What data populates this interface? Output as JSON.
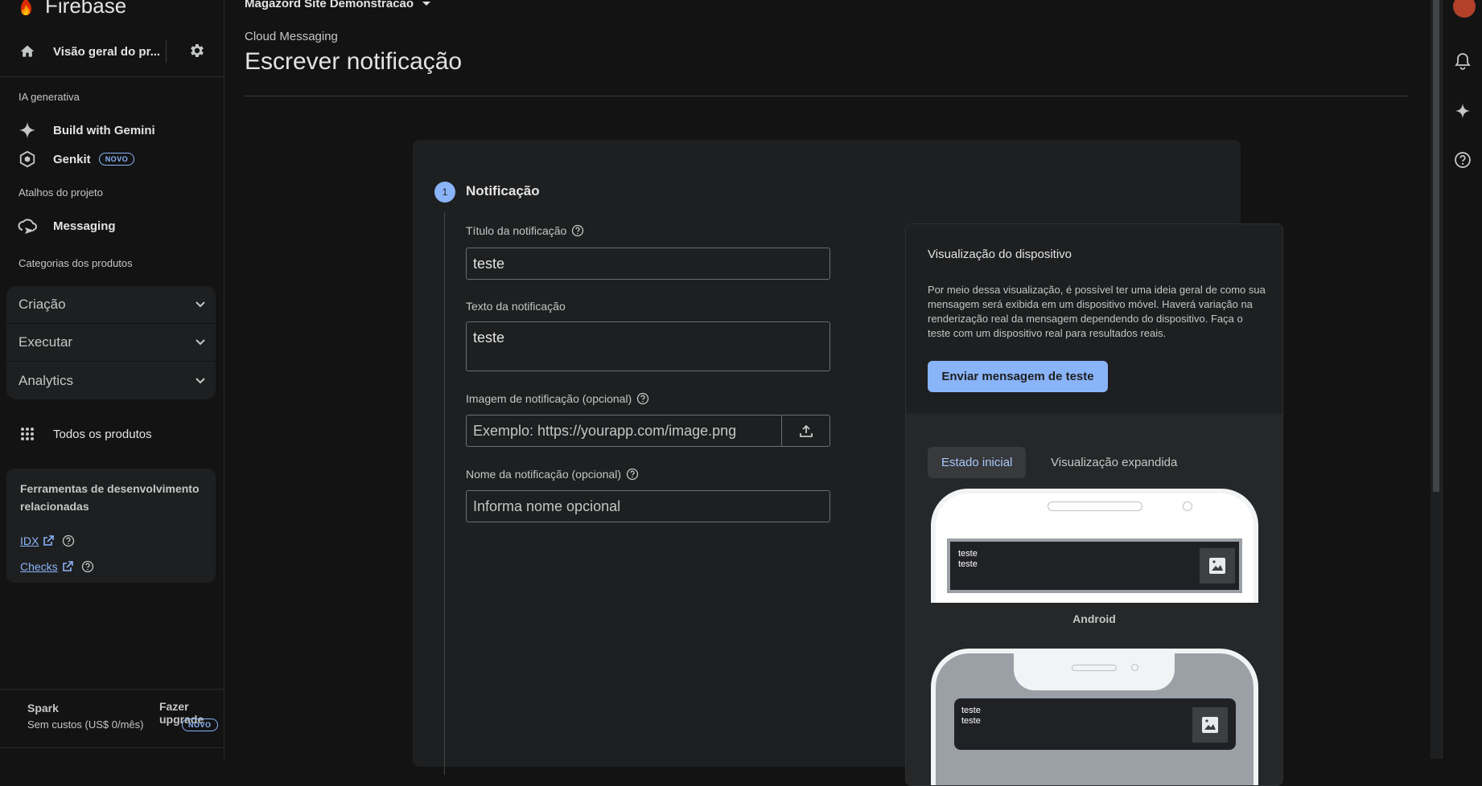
{
  "app": {
    "name": "Firebase",
    "project": "Magazord Site Demonstracao"
  },
  "sidebar": {
    "overview_label": "Visão geral do pr...",
    "sections": {
      "ai": "IA generativa",
      "shortcuts": "Atalhos do projeto",
      "categories": "Categorias dos produtos"
    },
    "ai_items": [
      {
        "label": "Build with Gemini"
      },
      {
        "label": "Genkit",
        "badge": "NOVO"
      }
    ],
    "shortcut_items": [
      {
        "label": "Messaging"
      }
    ],
    "groups": [
      "Criação",
      "Executar",
      "Analytics"
    ],
    "all_products": "Todos os produtos",
    "tools": {
      "title": "Ferramentas de desenvolvimento relacionadas",
      "links": [
        "IDX",
        "Checks"
      ]
    },
    "plan": {
      "name": "Spark",
      "cost": "Sem custos (US$ 0/mês)",
      "upgrade": "Fazer upgrade",
      "upgrade_badge": "NOVO"
    }
  },
  "header": {
    "breadcrumb": "Cloud Messaging",
    "title": "Escrever notificação"
  },
  "form": {
    "step_number": "1",
    "step_title": "Notificação",
    "title_label": "Título da notificação",
    "title_value": "teste",
    "text_label": "Texto da notificação",
    "text_value": "teste",
    "image_label": "Imagem de notificação (opcional)",
    "image_placeholder": "Exemplo: https://yourapp.com/image.png",
    "name_label": "Nome da notificação (opcional)",
    "name_placeholder": "Informa nome opcional"
  },
  "preview": {
    "title": "Visualização do dispositivo",
    "description": "Por meio dessa visualização, é possível ter uma ideia geral de como sua mensagem será exibida em um dispositivo móvel. Haverá variação na renderização real da mensagem dependendo do dispositivo. Faça o teste com um dispositivo real para resultados reais.",
    "send_button": "Enviar mensagem de teste",
    "tabs": [
      "Estado inicial",
      "Visualização expandida"
    ],
    "notification": {
      "title": "teste",
      "body": "teste"
    },
    "phone_label": "Android"
  },
  "colors": {
    "accent": "#8ab4f8",
    "background": "#131314",
    "surface": "#1e1f20"
  }
}
